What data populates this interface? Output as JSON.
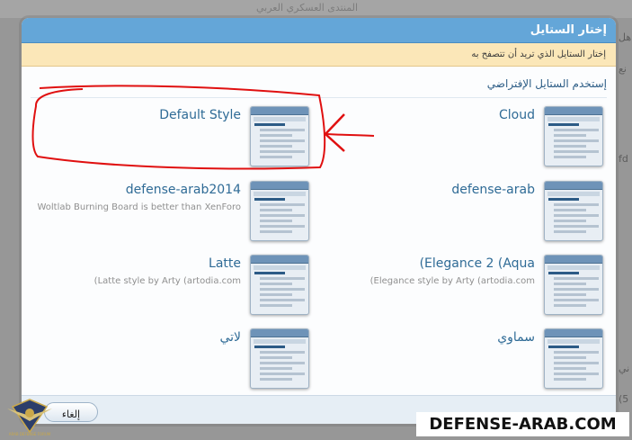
{
  "background": {
    "strip_text": "المنتدى العسكري العربي",
    "side_fragments": [
      "هل",
      "نع",
      "fd",
      "ني",
      "(5"
    ]
  },
  "dialog": {
    "title": "إختار الستايل",
    "notice": "إختار الستايل الذي تريد أن تتصفح به",
    "use_default": "إستخدم الستايل الإفتراضي",
    "cancel_label": "إلغاء",
    "title_color": "#64a6d8",
    "notice_color": "#fbe7b8"
  },
  "styles": [
    {
      "name": "Default Style",
      "description": "",
      "thumb_brand": "Fora",
      "thumb_title": "XenForo Community"
    },
    {
      "name": "Cloud",
      "description": "",
      "thumb_brand": "Fora",
      "thumb_title": "XenForo Community"
    },
    {
      "name": "defense-arab2014",
      "description": "Woltlab Burning Board is better than XenForo",
      "thumb_brand": "Fora",
      "thumb_title": "XenForo Community"
    },
    {
      "name": "defense-arab",
      "description": "",
      "thumb_brand": "Fora",
      "thumb_title": "XenForo Community"
    },
    {
      "name": "Latte",
      "description": "(Latte style by Arty (artodia.com",
      "thumb_brand": "Fora",
      "thumb_title": "XenForo Community"
    },
    {
      "name": "(Elegance 2 (Aqua",
      "description": "(Elegance style by Arty (artodia.com",
      "thumb_brand": "Fora",
      "thumb_title": "XenForo Community"
    },
    {
      "name": "لاتي",
      "description": "",
      "thumb_brand": "Fora",
      "thumb_title": "XenForo Community"
    },
    {
      "name": "سماوي",
      "description": "",
      "thumb_brand": "Fora",
      "thumb_title": "XenForo Community"
    }
  ],
  "annotation": {
    "color": "#e01010"
  },
  "watermark": {
    "text": "DEFENSE-ARAB.COM",
    "logo_text": "ARAB DEFENSE FORUM"
  }
}
